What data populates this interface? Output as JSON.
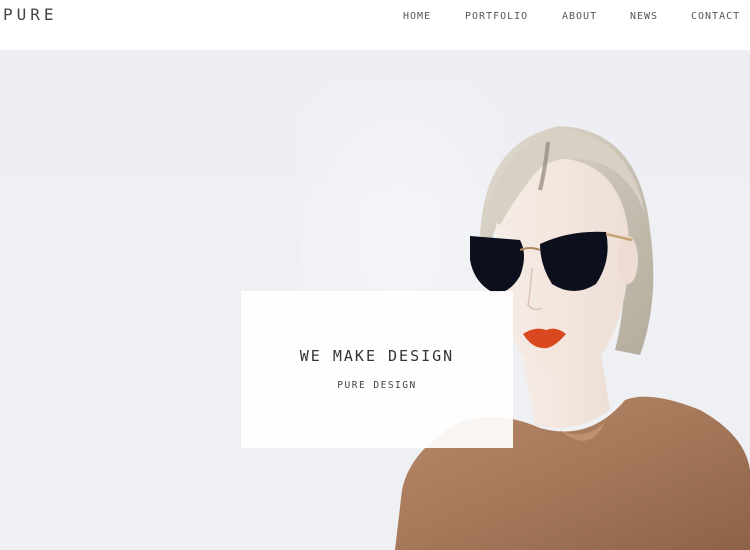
{
  "header": {
    "logo": "PURE",
    "nav": {
      "home": "HOME",
      "portfolio": "PORTFOLIO",
      "about": "ABOUT",
      "news": "NEWS",
      "contact": "CONTACT"
    }
  },
  "hero": {
    "title": "WE MAKE DESIGN",
    "subtitle": "PURE DESIGN",
    "image": "woman-in-sunglasses"
  },
  "colors": {
    "background": "#ffffff",
    "hero_background": "#eceef3",
    "text": "#333333",
    "sweater": "#a6785a",
    "lips": "#d9481f"
  }
}
